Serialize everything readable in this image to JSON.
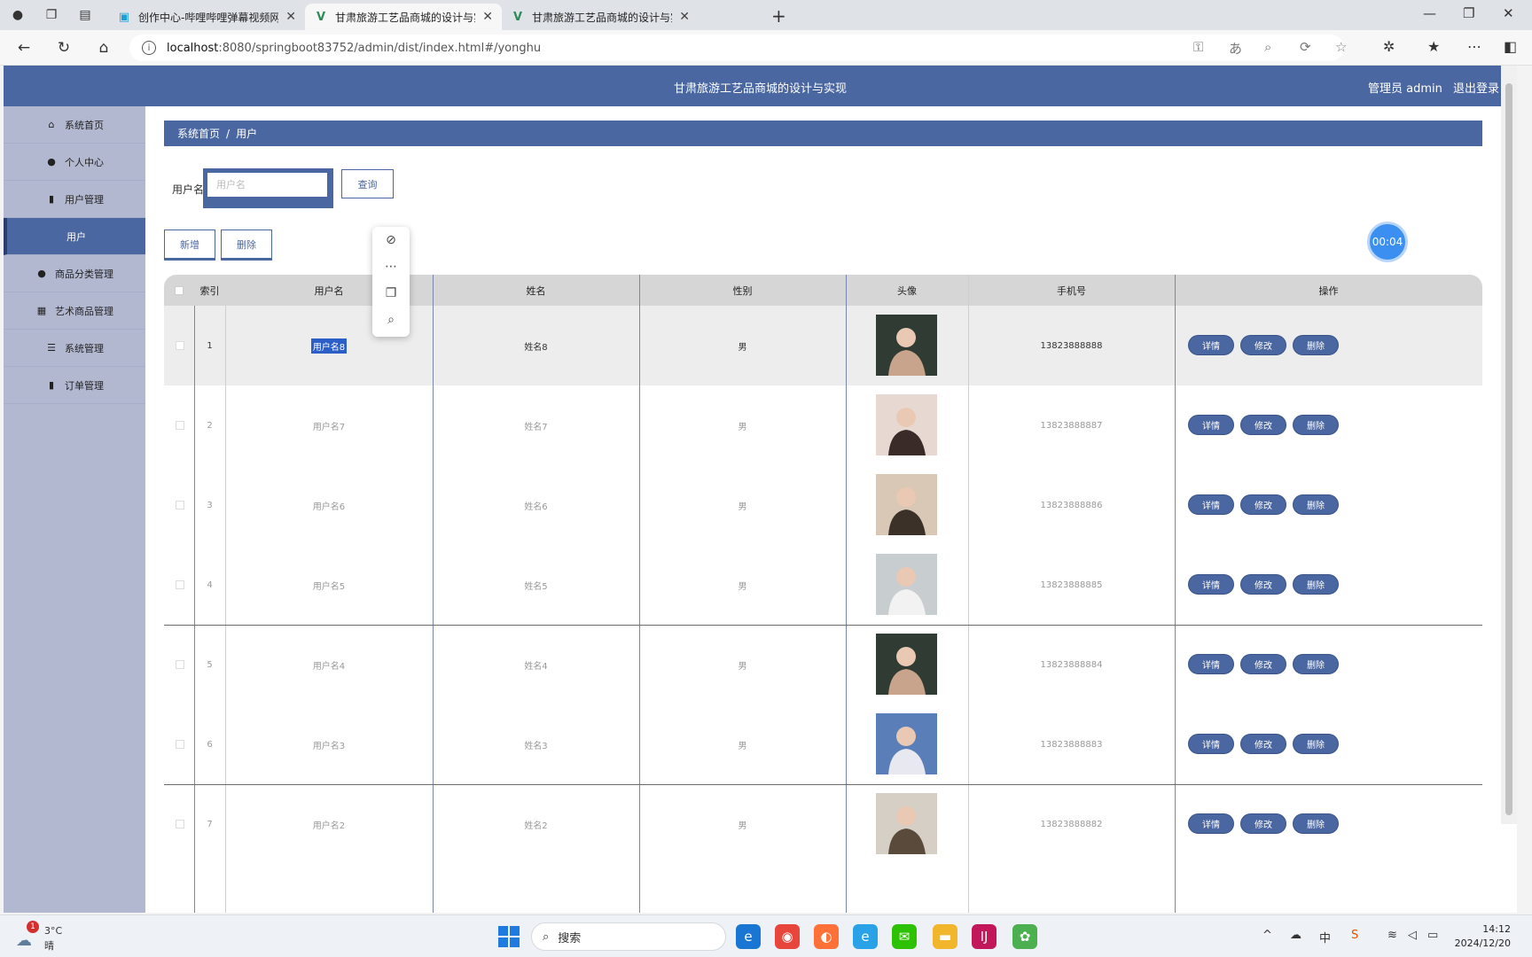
{
  "browser": {
    "tabs": [
      {
        "label": "创作中心-哔哩哔哩弹幕视频网",
        "icon": "bilibili-icon"
      },
      {
        "label": "甘肃旅游工艺品商城的设计与实现",
        "icon": "vue-icon"
      },
      {
        "label": "甘肃旅游工艺品商城的设计与实现",
        "icon": "vue-icon"
      }
    ],
    "url_host": "localhost",
    "url_rest": ":8080/springboot83752/admin/dist/index.html#/yonghu"
  },
  "header": {
    "title": "甘肃旅游工艺品商城的设计与实现",
    "user_label": "管理员 admin",
    "logout": "退出登录"
  },
  "sidebar": {
    "items": [
      {
        "label": "系统首页",
        "icon": "home-icon"
      },
      {
        "label": "个人中心",
        "icon": "user-icon"
      },
      {
        "label": "用户管理",
        "icon": "clipboard-icon"
      },
      {
        "label": "用户",
        "icon": "",
        "sub": true
      },
      {
        "label": "商品分类管理",
        "icon": "user-icon"
      },
      {
        "label": "艺术商品管理",
        "icon": "grid-icon"
      },
      {
        "label": "系统管理",
        "icon": "list-icon"
      },
      {
        "label": "订单管理",
        "icon": "clipboard-icon"
      }
    ]
  },
  "breadcrumb": {
    "home": "系统首页",
    "current": "用户"
  },
  "search": {
    "label": "用户名",
    "placeholder": "用户名",
    "button": "查询"
  },
  "actions": {
    "add": "新增",
    "delete": "删除"
  },
  "timer": "00:04",
  "table": {
    "headers": [
      "索引",
      "用户名",
      "姓名",
      "性别",
      "头像",
      "手机号",
      "操作"
    ],
    "action_labels": [
      "详情",
      "修改",
      "删除"
    ],
    "rows": [
      {
        "index": "1",
        "username": "用户名8",
        "name": "姓名8",
        "gender": "男",
        "phone": "13823888888"
      },
      {
        "index": "2",
        "username": "用户名7",
        "name": "姓名7",
        "gender": "男",
        "phone": "13823888887"
      },
      {
        "index": "3",
        "username": "用户名6",
        "name": "姓名6",
        "gender": "男",
        "phone": "13823888886"
      },
      {
        "index": "4",
        "username": "用户名5",
        "name": "姓名5",
        "gender": "男",
        "phone": "13823888885"
      },
      {
        "index": "5",
        "username": "用户名4",
        "name": "姓名4",
        "gender": "男",
        "phone": "13823888884"
      },
      {
        "index": "6",
        "username": "用户名3",
        "name": "姓名3",
        "gender": "男",
        "phone": "13823888883"
      },
      {
        "index": "7",
        "username": "用户名2",
        "name": "姓名2",
        "gender": "男",
        "phone": "13823888882"
      }
    ]
  },
  "taskbar": {
    "temp": "3°C",
    "condition": "晴",
    "badge": "1",
    "search_placeholder": "搜索",
    "time": "14:12",
    "date": "2024/12/20"
  },
  "colors": {
    "primary": "#4a67a2",
    "sidebar": "#b2b8d0",
    "accent": "#3b8ff0"
  }
}
